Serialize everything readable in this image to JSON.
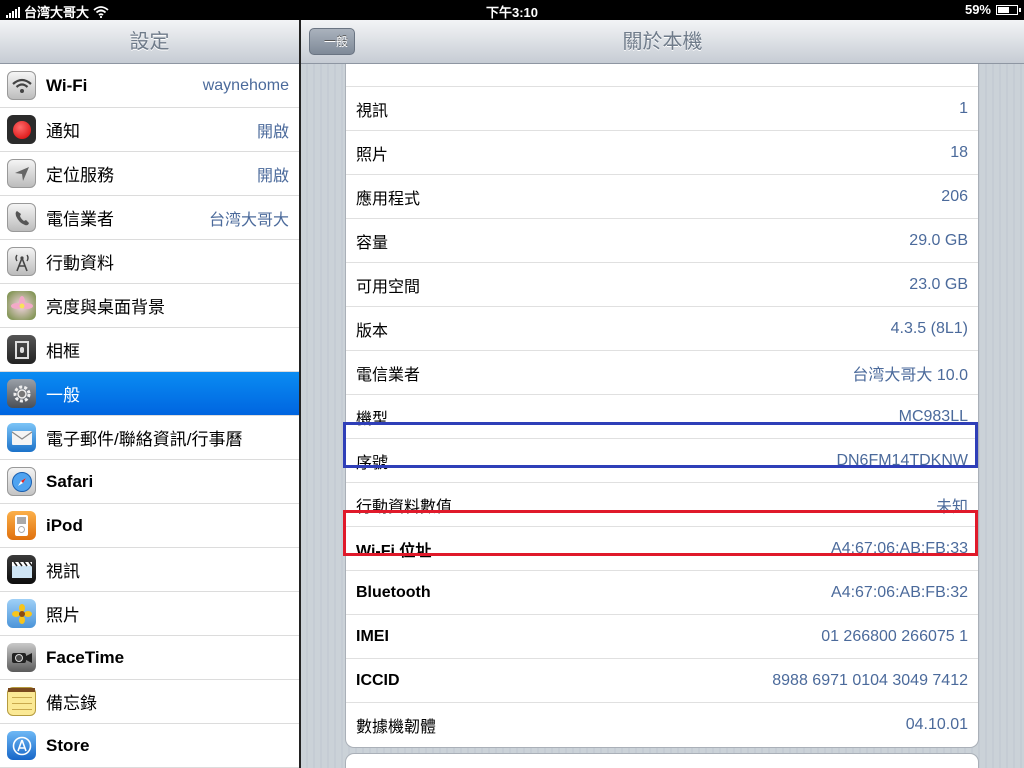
{
  "status": {
    "carrier": "台湾大哥大",
    "time": "下午3:10",
    "battery": "59%",
    "battery_level": 0.59
  },
  "master": {
    "title": "設定",
    "items": [
      {
        "label": "Wi-Fi",
        "value": "waynehome",
        "icon": "wifi-icon"
      },
      {
        "label": "通知",
        "value": "開啟",
        "icon": "notifications-icon"
      },
      {
        "label": "定位服務",
        "value": "開啟",
        "icon": "location-icon"
      },
      {
        "label": "電信業者",
        "value": "台湾大哥大",
        "icon": "phone-icon"
      },
      {
        "label": "行動資料",
        "value": "",
        "icon": "cellular-icon"
      },
      {
        "label": "亮度與桌面背景",
        "value": "",
        "icon": "brightness-icon"
      },
      {
        "label": "相框",
        "value": "",
        "icon": "picture-frame-icon"
      },
      {
        "label": "一般",
        "value": "",
        "icon": "gear-icon"
      },
      {
        "label": "電子郵件/聯絡資訊/行事曆",
        "value": "",
        "icon": "mail-icon"
      },
      {
        "label": "Safari",
        "value": "",
        "icon": "safari-icon"
      },
      {
        "label": "iPod",
        "value": "",
        "icon": "ipod-icon"
      },
      {
        "label": "視訊",
        "value": "",
        "icon": "video-icon"
      },
      {
        "label": "照片",
        "value": "",
        "icon": "photos-icon"
      },
      {
        "label": "FaceTime",
        "value": "",
        "icon": "facetime-icon"
      },
      {
        "label": "備忘錄",
        "value": "",
        "icon": "notes-icon"
      },
      {
        "label": "Store",
        "value": "",
        "icon": "store-icon"
      }
    ]
  },
  "detail": {
    "back_label": "一般",
    "title": "關於本機",
    "rows": [
      {
        "key": "視訊",
        "value": "1"
      },
      {
        "key": "照片",
        "value": "18"
      },
      {
        "key": "應用程式",
        "value": "206"
      },
      {
        "key": "容量",
        "value": "29.0 GB"
      },
      {
        "key": "可用空間",
        "value": "23.0 GB"
      },
      {
        "key": "版本",
        "value": "4.3.5 (8L1)"
      },
      {
        "key": "電信業者",
        "value": "台湾大哥大 10.0"
      },
      {
        "key": "機型",
        "value": "MC983LL"
      },
      {
        "key": "序號",
        "value": "DN6FM14TDKNW"
      },
      {
        "key": "行動資料數值",
        "value": "未知"
      },
      {
        "key": "Wi-Fi 位址",
        "value": "A4:67:06:AB:FB:33"
      },
      {
        "key": "Bluetooth",
        "value": "A4:67:06:AB:FB:32"
      },
      {
        "key": "IMEI",
        "value": "01 266800 266075 1"
      },
      {
        "key": "ICCID",
        "value": "8988 6971 0104 3049 7412"
      },
      {
        "key": "數據機韌體",
        "value": "04.10.01"
      }
    ]
  },
  "highlight_colors": {
    "serial": "#2f3fb8",
    "wifi_address": "#e0192a"
  }
}
